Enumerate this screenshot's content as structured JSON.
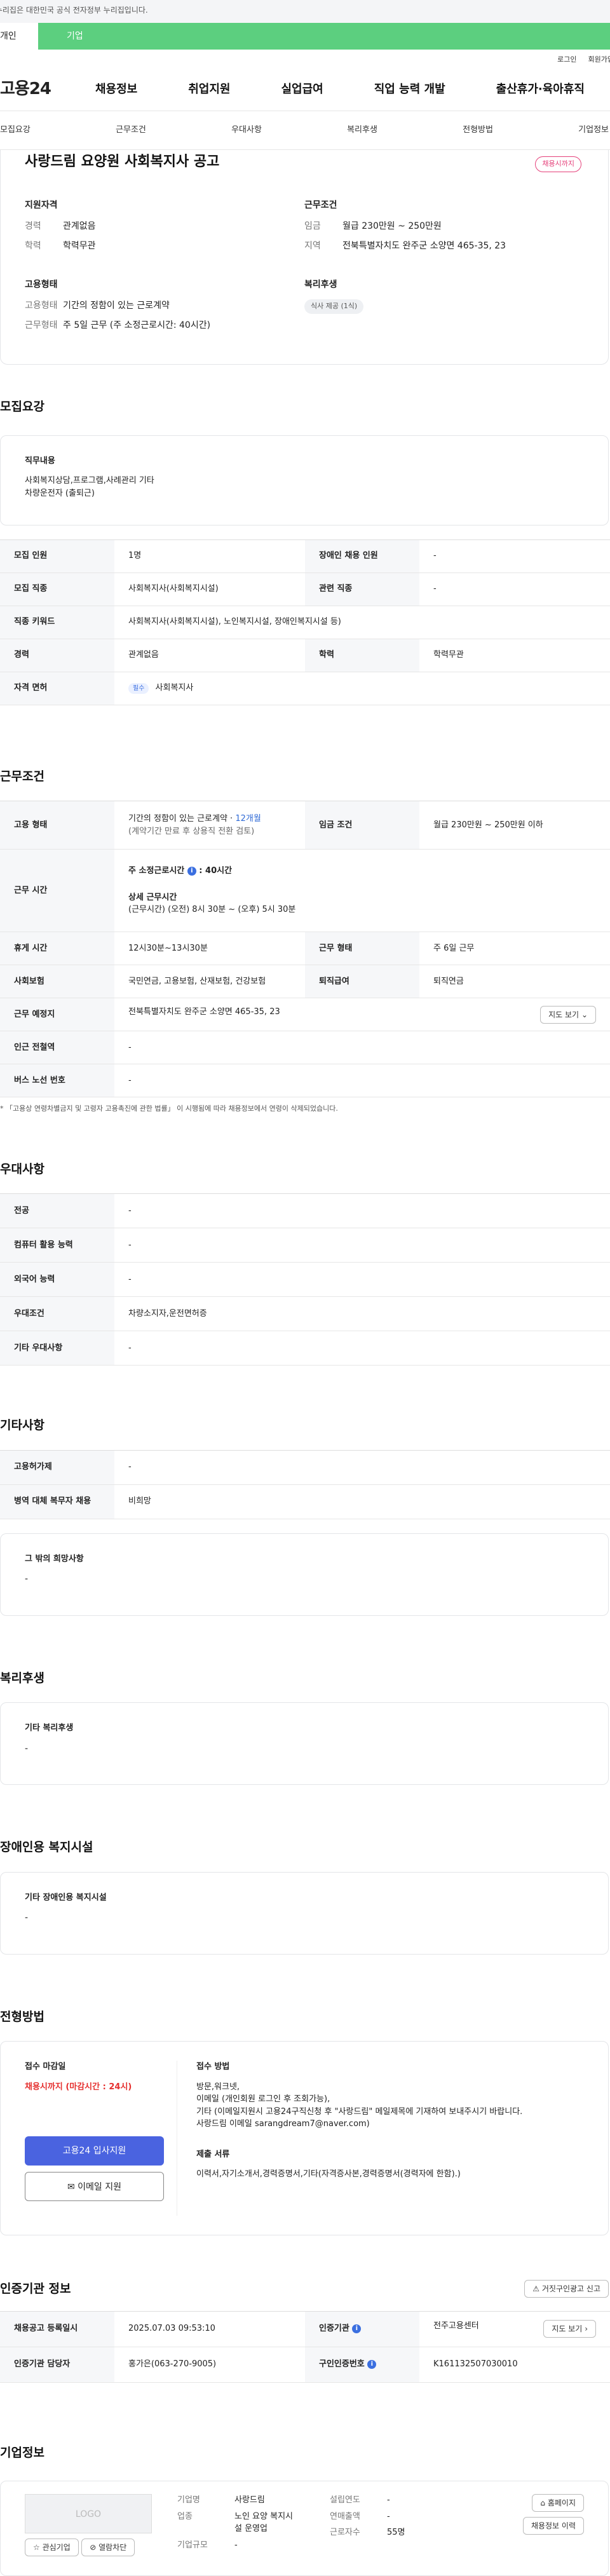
{
  "banner": {
    "text": "이 누리집은 대한민국 공식 전자정부 누리집입니다."
  },
  "tabs": {
    "individual": "개인",
    "business": "기업"
  },
  "util": {
    "login": "로그인",
    "signup": "회원가입"
  },
  "gnb": {
    "logo": "고용24",
    "items": [
      "채용정보",
      "취업지원",
      "실업급여",
      "직업 능력 개발",
      "출산휴가·육아휴직"
    ]
  },
  "subnav": [
    "모집요강",
    "근무조건",
    "우대사항",
    "복리후생",
    "전형방법",
    "기업정보"
  ],
  "header": {
    "title": "사랑드림 요양원 사회복지사 공고",
    "badge": "채용시까지",
    "qual": {
      "heading": "지원자격",
      "career_k": "경력",
      "career_v": "관계없음",
      "edu_k": "학력",
      "edu_v": "학력무관"
    },
    "cond": {
      "heading": "근무조건",
      "pay_k": "임금",
      "pay_v": "월급 230만원 ~ 250만원",
      "loc_k": "지역",
      "loc_v": "전북특별자치도 완주군 소양면 465-35, 23"
    },
    "emp": {
      "heading": "고용형태",
      "type_k": "고용형태",
      "type_v": "기간의 정함이 있는 근로계약",
      "work_k": "근무형태",
      "work_v": "주 5일 근무 (주 소정근로시간: 40시간)"
    },
    "welfare": {
      "heading": "복리후생",
      "chip": "식사 제공 (1식)"
    }
  },
  "recruit": {
    "title": "모집요강",
    "duty_h": "직무내용",
    "duty_lines": [
      "사회복지상담,프로그램,사례관리 기타",
      "차량운전자 (출퇴근)"
    ],
    "rows": {
      "count_k": "모집 인원",
      "count_v": "1명",
      "disabled_k": "장애인 채용 인원",
      "disabled_v": "-",
      "job_k": "모집 직종",
      "job_v": "사회복지사(사회복지시설)",
      "related_k": "관련 직종",
      "related_v": "-",
      "kw_k": "직종 키워드",
      "kw_v": "사회복지사(사회복지시설), 노인복지시설, 장애인복지시설 등)",
      "career_k": "경력",
      "career_v": "관계없음",
      "edu_k": "학력",
      "edu_v": "학력무관",
      "license_k": "자격 면허",
      "license_tag": "필수",
      "license_v": "사회복지사"
    }
  },
  "work": {
    "title": "근무조건",
    "emp_k": "고용 형태",
    "emp_v1": "기간의 정함이 있는 근로계약 · ",
    "emp_months": "12개월",
    "emp_v2": "(계약기간 만료 후 상용직 전환 검토)",
    "pay_k": "임금 조건",
    "pay_v": "월급 230만원 ~ 250만원 이하",
    "hours_k": "근무 시간",
    "hours_h": "주 소정근로시간",
    "hours_hv": "40시간",
    "hours_sub": "상세 근무시간",
    "hours_detail": "(근무시간) (오전) 8시 30분 ~ (오후) 5시 30분",
    "break_k": "휴게 시간",
    "break_v": "12시30분~13시30분",
    "shift_k": "근무 형태",
    "shift_v": "주 6일 근무",
    "ins_k": "사회보험",
    "ins_v": "국민연금, 고용보험, 산재보험, 건강보험",
    "sev_k": "퇴직급여",
    "sev_v": "퇴직연금",
    "place_k": "근무 예정지",
    "place_v": "전북특별자치도 완주군 소양면 465-35, 23",
    "map_btn": "지도 보기",
    "sub_k": "인근 전철역",
    "sub_v": "-",
    "bus_k": "버스 노선 번호",
    "bus_v": "-",
    "note": "* 「고용상 연령차별금지 및 고령자 고용촉진에 관한 법률」 이 시행됨에 따라 채용정보에서 연령이 삭제되었습니다."
  },
  "pref": {
    "title": "우대사항",
    "rows": [
      [
        "전공",
        "-"
      ],
      [
        "컴퓨터 활용 능력",
        "-"
      ],
      [
        "외국어 능력",
        "-"
      ],
      [
        "우대조건",
        "차량소지자,운전면허증"
      ],
      [
        "기타 우대사항",
        "-"
      ]
    ]
  },
  "etc": {
    "title": "기타사항",
    "rows": [
      [
        "고용허가제",
        "-"
      ],
      [
        "병역 대체 복무자 채용",
        "비희망"
      ]
    ],
    "box_h": "그 밖의 희망사항",
    "box_v": "-"
  },
  "welfare": {
    "title": "복리후생",
    "box_h": "기타 복리후생",
    "box_v": "-"
  },
  "disab": {
    "title": "장애인용 복지시설",
    "box_h": "기타 장애인용 복지시설",
    "box_v": "-"
  },
  "process": {
    "title": "전형방법",
    "deadline_h": "접수 마감일",
    "deadline_v": "채용시까지 (마감시간 : 24시)",
    "apply_btn": "고용24 입사지원",
    "email_btn": "이메일 지원",
    "method_h": "접수 방법",
    "method_lines": [
      "방문,워크넷,",
      "이메일 (개인회원 로그인 후 조회가능),",
      "기타 (이메일지원시 고용24구직신청 후  \"사랑드림\" 메일제목에 기재하여 보내주시기 바랍니다.",
      "사랑드림 이메일 sarangdream7@naver.com)"
    ],
    "docs_h": "제출 서류",
    "docs_v": "이력서,자기소개서,경력증명서,기타(자격증사본,경력증명서(경력자에 한함).)"
  },
  "agency": {
    "title": "인증기관 정보",
    "report_btn": "거짓구인광고 신고",
    "reg_k": "채용공고 등록일시",
    "reg_v": "2025.07.03 09:53:10",
    "org_k": "인증기관",
    "org_v": "전주고용센터",
    "map_btn": "지도 보기",
    "mgr_k": "인증기관 담당자",
    "mgr_v": "홍가은(063-270-9005)",
    "num_k": "구인인증번호",
    "num_v": "K161132507030010"
  },
  "company": {
    "title": "기업정보",
    "logo_text": "LOGO",
    "fav_btn": "관심기업",
    "block_btn": "열람차단",
    "name_k": "기업명",
    "name_v": "사랑드림",
    "biz_k": "업종",
    "biz_v1": "노인 요양 복지시",
    "biz_v2": "설 운영업",
    "size_k": "기업규모",
    "size_v": "-",
    "year_k": "설립연도",
    "year_v": "-",
    "sales_k": "연매출액",
    "sales_v": "-",
    "emp_k": "근로자수",
    "emp_v": "55명",
    "home_btn": "홈페이지",
    "history_btn": "채용정보 이력"
  }
}
